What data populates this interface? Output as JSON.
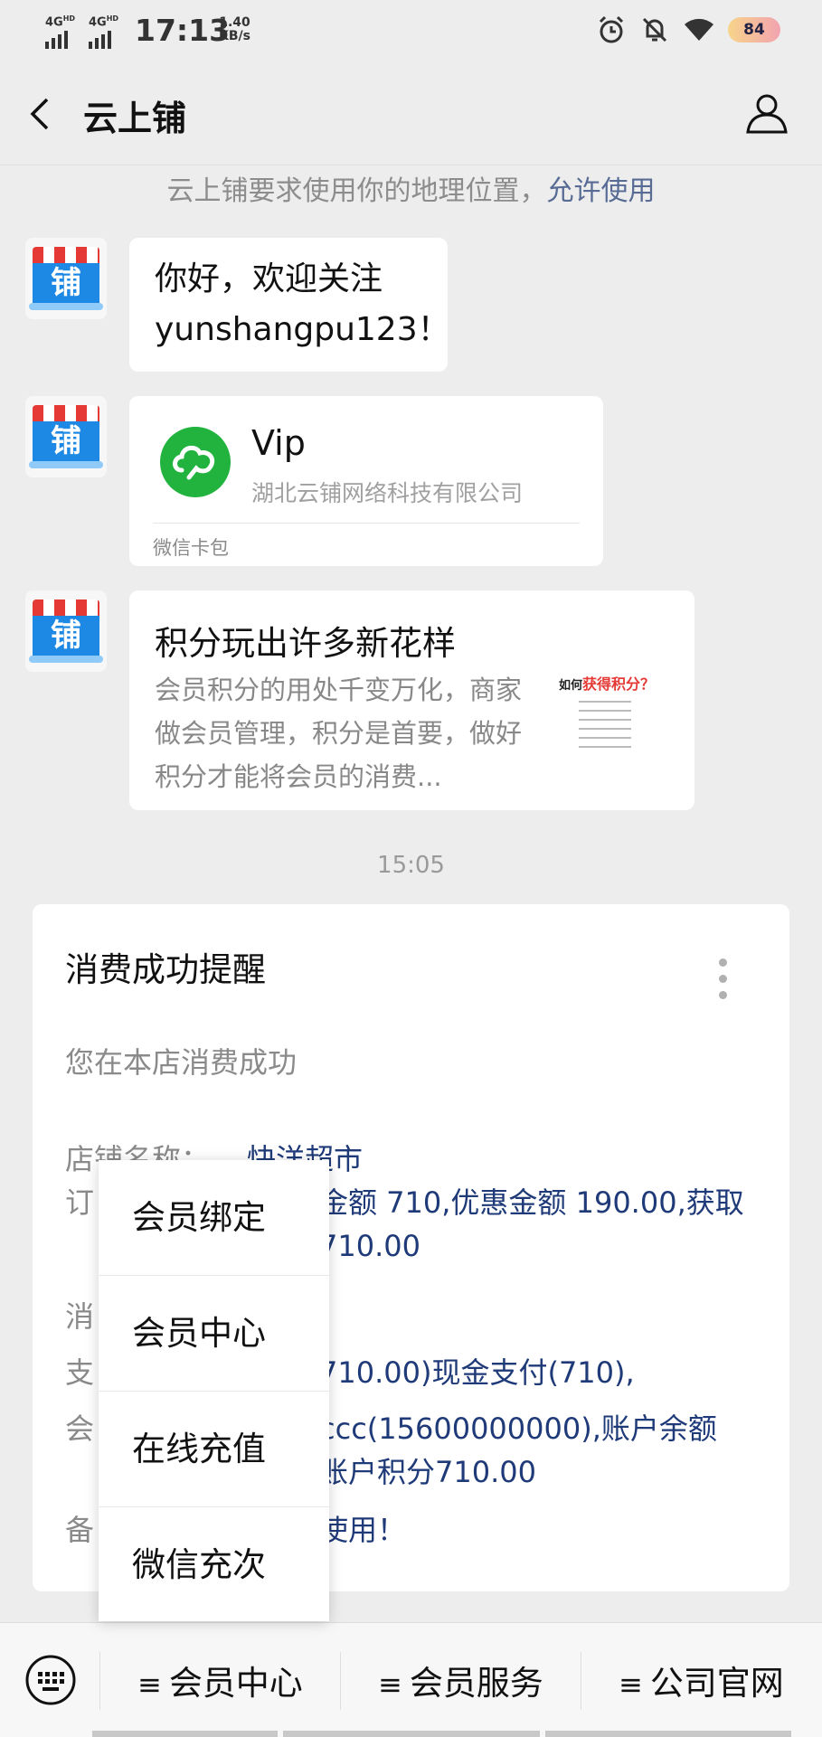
{
  "status_bar": {
    "net1": "4G",
    "net1_sup": "HD",
    "net2": "4G",
    "net2_sup": "HD",
    "time": "17:13",
    "speed_value": "1.40",
    "speed_unit": "KB/s",
    "battery": "84",
    "icons": [
      "alarm-icon",
      "bell-muted-icon",
      "wifi-icon",
      "battery-icon"
    ]
  },
  "header": {
    "title": "云上铺"
  },
  "location_tip": {
    "text": "云上铺要求使用你的地理位置，",
    "action": "允许使用"
  },
  "avatar": {
    "glyph": "铺"
  },
  "messages": {
    "welcome": "你好，欢迎关注yunshangpu123！",
    "card": {
      "title": "Vip",
      "company": "湖北云铺网络科技有限公司",
      "footer": "微信卡包"
    },
    "article": {
      "title": "积分玩出许多新花样",
      "description": "会员积分的用处千变万化，商家做会员管理，积分是首要，做好积分才能将会员的消费...",
      "thumb_title_a": "如何",
      "thumb_title_b": "获得积分？"
    }
  },
  "time_divider": "15:05",
  "template": {
    "title": "消费成功提醒",
    "intro": "您在本店消费成功",
    "store_label": "店铺名称：",
    "store_value": "快洋超市",
    "order_label_partial": "订",
    "order_value_line1": "金额 710,优惠金额 190.00,获取",
    "order_value_line2": "710.00",
    "consume_label_partial": "消",
    "pay_label_partial": "支",
    "pay_value": "710.00)现金支付(710),",
    "member_label_partial": "会",
    "member_value_line1": "ccc(15600000000),账户余额",
    "member_value_line2": "账户积分710.00",
    "remark_label_partial": "备",
    "remark_value": "使用！"
  },
  "popup_menu": {
    "items": [
      "会员绑定",
      "会员中心",
      "在线充值",
      "微信充次"
    ]
  },
  "bottom_menu": {
    "ham": "≡",
    "tabs": [
      "会员中心",
      "会员服务",
      "公司官网"
    ]
  }
}
